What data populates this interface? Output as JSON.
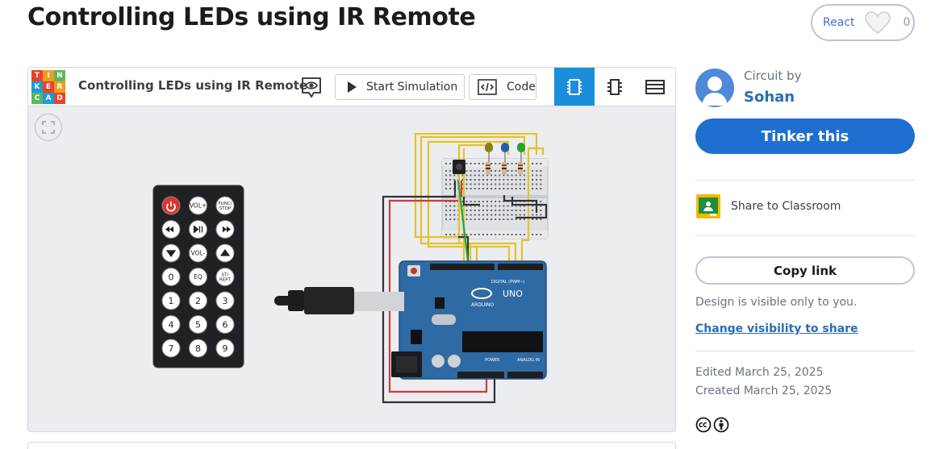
{
  "page": {
    "title": "Controlling LEDs using IR Remote"
  },
  "react": {
    "label": "React",
    "count": "0"
  },
  "editor": {
    "logo_letters": [
      "T",
      "I",
      "N",
      "K",
      "E",
      "R",
      "C",
      "A",
      "D"
    ],
    "logo_colors": [
      "#e8432b",
      "#f29c1f",
      "#5cb85c",
      "#1f9bd7",
      "#e8432b",
      "#f29c1f",
      "#5cb85c",
      "#1f9bd7",
      "#e8432b"
    ],
    "title": "Controlling LEDs using IR Remote",
    "start_simulation": "Start Simulation",
    "code": "Code",
    "views": [
      "circuit-view-icon",
      "schematic-view-icon",
      "component-list-icon"
    ],
    "active_view": "circuit-view-icon",
    "accent": "#1b8edb"
  },
  "remote": {
    "buttons": [
      [
        "power",
        "VOL+",
        "FUNC/STOP"
      ],
      [
        "prev",
        "play-pause",
        "next"
      ],
      [
        "down",
        "VOL-",
        "up"
      ],
      [
        "0",
        "EQ",
        "ST/REPT"
      ],
      [
        "1",
        "2",
        "3"
      ],
      [
        "4",
        "5",
        "6"
      ],
      [
        "7",
        "8",
        "9"
      ]
    ]
  },
  "arduino": {
    "brand": "ARDUINO",
    "model": "UNO",
    "digital_label": "DIGITAL (PWM~)",
    "power_label": "POWER",
    "analog_label": "ANALOG IN"
  },
  "leds": [
    "#8b7d1a",
    "#1f5fb0",
    "#2aa12a"
  ],
  "sidebar": {
    "circuit_by": "Circuit by",
    "author": "Sohan",
    "tinker_button": "Tinker this",
    "share_classroom": "Share to Classroom",
    "copy_link": "Copy link",
    "visibility_note": "Design is visible only to you.",
    "visibility_link": "Change visibility to share",
    "edited": "Edited March 25, 2025",
    "created": "Created March 25, 2025",
    "brand_color": "#1f6fd1"
  }
}
